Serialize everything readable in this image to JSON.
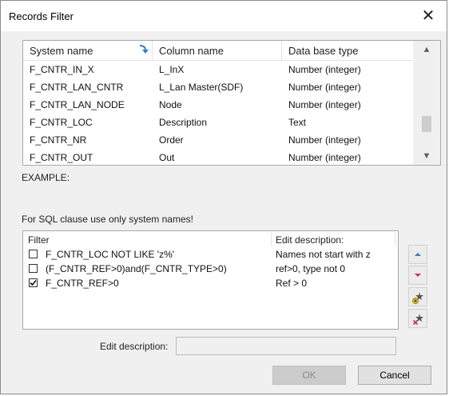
{
  "window": {
    "title": "Records Filter",
    "close_glyph": "✕"
  },
  "columns_table": {
    "headers": [
      "System name",
      "Column name",
      "Data base type"
    ],
    "rows": [
      [
        "F_CNTR_IN_X",
        "L_InX",
        "Number (integer)"
      ],
      [
        "F_CNTR_LAN_CNTR",
        "L_Lan Master(SDF)",
        "Number (integer)"
      ],
      [
        "F_CNTR_LAN_NODE",
        "Node",
        "Number (integer)"
      ],
      [
        "F_CNTR_LOC",
        "Description",
        "Text"
      ],
      [
        "F_CNTR_NR",
        "Order",
        "Number (integer)"
      ],
      [
        "F_CNTR_OUT",
        "Out",
        "Number (integer)"
      ]
    ]
  },
  "example_label": "EXAMPLE:",
  "sql_note": "For SQL clause use only system names!",
  "filter_list": {
    "headers": [
      "Filter",
      "Edit description:"
    ],
    "rows": [
      {
        "filter": "F_CNTR_LOC NOT LIKE 'z%'",
        "description": "Names not start with z",
        "checked": false
      },
      {
        "filter": "(F_CNTR_REF>0)and(F_CNTR_TYPE>0)",
        "description": "ref>0, type not 0",
        "checked": false
      },
      {
        "filter": "F_CNTR_REF>0",
        "description": "Ref > 0",
        "checked": true
      }
    ]
  },
  "side_buttons": [
    "move-up-icon",
    "move-down-icon",
    "add-filter-icon",
    "delete-filter-icon"
  ],
  "edit_description": {
    "label": "Edit description:",
    "value": ""
  },
  "buttons": {
    "ok": "OK",
    "cancel": "Cancel"
  },
  "colors": {
    "up_arrow": "#3a78c4",
    "down_arrow": "#d0343b",
    "ok_disabled": "#cccccc"
  }
}
